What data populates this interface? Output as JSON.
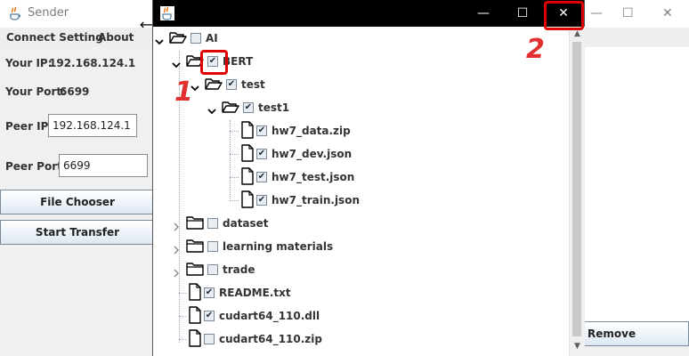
{
  "sender": {
    "title": "Sender",
    "controls": {
      "minimize": "—",
      "maximize": "☐",
      "close": "✕"
    },
    "menu": [
      "Connect Setting",
      "About"
    ],
    "your_ip_label": "Your IP:",
    "your_ip_value": "192.168.124.1",
    "your_port_label": "Your Port:",
    "your_port_value": "6699",
    "peer_ip_label": "Peer IP:",
    "peer_ip_value": "192.168.124.1",
    "peer_port_label": "Peer Port:",
    "peer_port_value": "6699",
    "file_chooser_button": "File Chooser",
    "start_transfer_button": "Start Transfer",
    "remove_button": "Remove"
  },
  "dialog": {
    "controls": {
      "minimize": "—",
      "maximize": "☐",
      "close": "✕"
    },
    "tree": [
      {
        "label": "AI",
        "type": "folder",
        "expander": "expanded",
        "checked": false
      },
      {
        "label": "BERT",
        "type": "folder",
        "expander": "expanded",
        "checked": true
      },
      {
        "label": "test",
        "type": "folder",
        "expander": "expanded",
        "checked": true
      },
      {
        "label": "test1",
        "type": "folder",
        "expander": "expanded",
        "checked": true
      },
      {
        "label": "hw7_data.zip",
        "type": "file",
        "checked": true
      },
      {
        "label": "hw7_dev.json",
        "type": "file",
        "checked": true
      },
      {
        "label": "hw7_test.json",
        "type": "file",
        "checked": true
      },
      {
        "label": "hw7_train.json",
        "type": "file",
        "checked": true
      },
      {
        "label": "dataset",
        "type": "folder",
        "expander": "collapsed",
        "checked": false
      },
      {
        "label": "learning materials",
        "type": "folder",
        "expander": "collapsed",
        "checked": false
      },
      {
        "label": "trade",
        "type": "folder",
        "expander": "collapsed",
        "checked": false
      },
      {
        "label": "README.txt",
        "type": "file",
        "checked": true
      },
      {
        "label": "cudart64_110.dll",
        "type": "file",
        "checked": true
      },
      {
        "label": "cudart64_110.zip",
        "type": "file",
        "checked": false
      }
    ]
  },
  "annotations": {
    "marker_1": "1",
    "marker_2": "2",
    "color": "#e00000"
  },
  "colors": {
    "dialog_titlebar": "#000000",
    "button_gradient_top": "#ffffff",
    "button_gradient_bottom": "#dde8f3"
  }
}
